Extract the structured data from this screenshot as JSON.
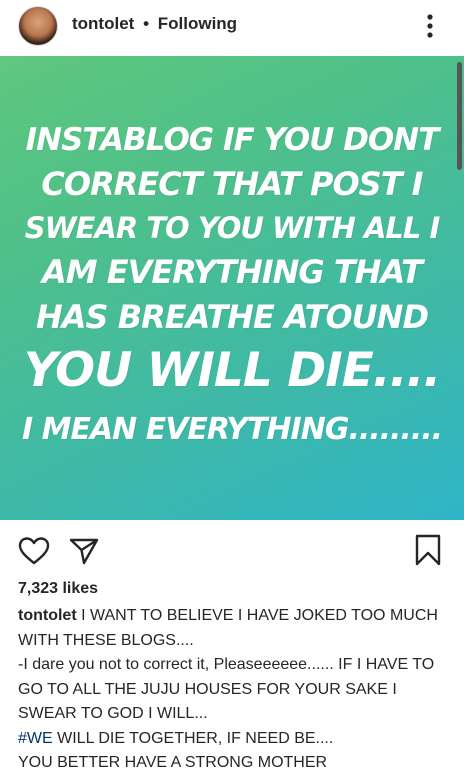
{
  "header": {
    "username": "tontolet",
    "separator": "•",
    "follow_status": "Following"
  },
  "post": {
    "lines": [
      "INSTABLOG IF YOU DONT",
      "CORRECT THAT POST I",
      "SWEAR TO YOU WITH ALL I",
      "AM EVERYTHING THAT",
      "HAS BREATHE ATOUND",
      "YOU WILL DIE....",
      "I MEAN EVERYTHING........."
    ],
    "background_colors": [
      "#5fc87e",
      "#2fb5c8"
    ]
  },
  "actions": {
    "like_icon": "heart-icon",
    "share_icon": "send-icon",
    "save_icon": "bookmark-icon"
  },
  "likes": "7,323 likes",
  "caption": {
    "username": "tontolet",
    "line1": "I WANT TO BELIEVE I HAVE JOKED TOO MUCH WITH THESE BLOGS....",
    "line2": "-I dare you not to correct it, Pleaseeeeee...... IF I HAVE TO GO TO ALL THE JUJU HOUSES FOR YOUR SAKE I SWEAR TO GOD I WILL...",
    "hashtag": "#WE",
    "line3": " WILL DIE TOGETHER, IF NEED BE....",
    "line4": "YOU BETTER HAVE A STRONG MOTHER"
  }
}
